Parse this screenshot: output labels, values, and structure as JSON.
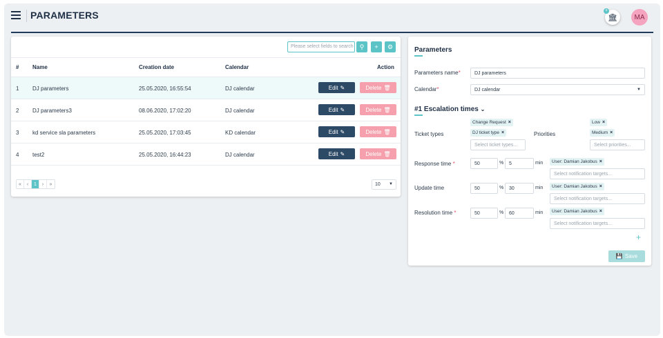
{
  "header": {
    "title": "PARAMETERS",
    "avatar_initials": "MA"
  },
  "toolbar": {
    "search_placeholder": "Please select fields to search"
  },
  "table": {
    "columns": [
      "#",
      "Name",
      "Creation date",
      "Calendar",
      "Action"
    ],
    "edit_label": "Edit",
    "delete_label": "Delete",
    "rows": [
      {
        "num": "1",
        "name": "DJ parameters",
        "date": "25.05.2020, 16:55:54",
        "calendar": "DJ calendar"
      },
      {
        "num": "2",
        "name": "DJ parameters3",
        "date": "08.06.2020, 17:02:20",
        "calendar": "DJ calendar"
      },
      {
        "num": "3",
        "name": "kd service sla parameters",
        "date": "25.05.2020, 17:03:45",
        "calendar": "KD calendar"
      },
      {
        "num": "4",
        "name": "test2",
        "date": "25.05.2020, 16:44:23",
        "calendar": "DJ calendar"
      }
    ],
    "pagination": {
      "first": "«",
      "prev": "‹",
      "page": "1",
      "next": "›",
      "last": "»"
    },
    "page_size": "10"
  },
  "form": {
    "title": "Parameters",
    "name_label": "Parameters name",
    "name_value": "DJ parameters",
    "calendar_label": "Calendar",
    "calendar_value": "DJ calendar",
    "escalation_title": "#1 Escalation times",
    "ticket_types_label": "Ticket types",
    "ticket_types": [
      "Change Request",
      "DJ ticket type"
    ],
    "ticket_types_placeholder": "Select ticket types...",
    "priorities_label": "Priorities",
    "priorities": [
      "Low",
      "Medium"
    ],
    "priorities_placeholder": "Select priorities...",
    "response_label": "Response time",
    "response_pct": "50",
    "response_min": "5",
    "update_label": "Update time",
    "update_pct": "50",
    "update_min": "30",
    "resolution_label": "Resolution time",
    "resolution_pct": "50",
    "resolution_min": "60",
    "pct_sign": "%",
    "min_label": "min",
    "target_chip": "User: Damian Jakobus",
    "target_placeholder": "Select notification targets...",
    "save_label": "Save"
  },
  "colors": {
    "accent": "#5cc3c7",
    "dark": "#2c4a66",
    "danger": "#f5a0ac"
  }
}
